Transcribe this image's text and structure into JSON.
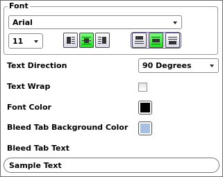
{
  "font_group": {
    "legend": "Font",
    "font_name": "Arial",
    "font_size": "11",
    "horizontal_align": [
      "left",
      "center",
      "right"
    ],
    "horizontal_active": "center",
    "vertical_align": [
      "top",
      "middle",
      "bottom"
    ],
    "vertical_active": "middle"
  },
  "text_direction": {
    "label": "Text Direction",
    "value": "90 Degrees"
  },
  "text_wrap": {
    "label": "Text Wrap",
    "checked": false
  },
  "font_color": {
    "label": "Font Color",
    "color": "#000000"
  },
  "bleed_bg_color": {
    "label": "Bleed Tab Background Color",
    "color": "#a8c0e0"
  },
  "bleed_text": {
    "label": "Bleed Tab Text",
    "value": "Sample Text"
  },
  "colors": {
    "active_button": "#33ee33",
    "vertical_group_bg": "#dfe1ff"
  }
}
